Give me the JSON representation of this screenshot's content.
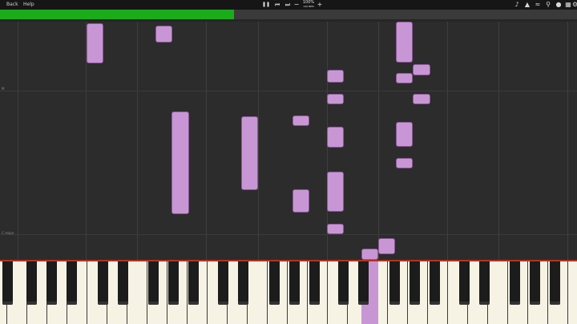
{
  "menu": {
    "back": "Back",
    "help": "Help"
  },
  "transport": {
    "pause": "❚❚",
    "prev": "⏮",
    "next": "⏭",
    "minus": "−",
    "plus": "+"
  },
  "speed": {
    "percent": "100%",
    "bpm": "120 BPM"
  },
  "progress": {
    "fraction": 0.405,
    "caption": "1/4 2",
    "color": "#1aad1a"
  },
  "lane_labels": {
    "upper": "M",
    "lower": "C major"
  },
  "icons": [
    "note-icon",
    "metronome-icon",
    "waveform-icon",
    "search-icon",
    "pin-icon",
    "keyboard-icon",
    "settings-icon"
  ],
  "colors": {
    "note": "#c996d5",
    "divider": "#b3331e",
    "progress": "#1aad1a"
  }
}
